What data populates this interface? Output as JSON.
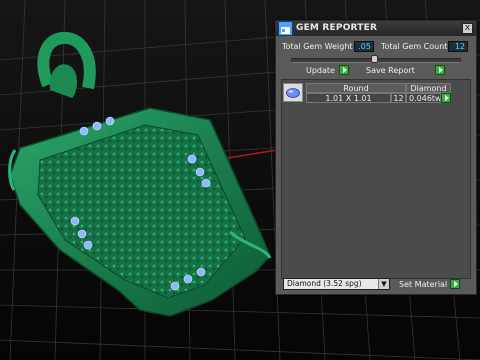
{
  "window": {
    "title": "GEM REPORTER",
    "close_glyph": "x"
  },
  "stats": {
    "total_gem_weight_label": "Total Gem Weight",
    "total_gem_weight_value": ".05",
    "total_gem_count_label": "Total Gem Count",
    "total_gem_count_value": "12"
  },
  "actions": {
    "update_label": "Update",
    "save_report_label": "Save Report"
  },
  "table": {
    "shape_header": "Round",
    "material_header": "Diamond",
    "rows": [
      {
        "size": "1.01 X 1.01",
        "count": "12",
        "weight": "0.046tw"
      }
    ]
  },
  "footer": {
    "material_selected": "Diamond    (3.52 spg)",
    "set_material_label": "Set Material"
  },
  "colors": {
    "model_green": "#1f8f5a",
    "gem_marker": "#8fb8ff",
    "value_text": "#4fd1ff",
    "go_button": "#34b23a"
  },
  "icons": {
    "app": "app-icon",
    "close": "close-icon",
    "gem": "round-gem-icon",
    "go": "play-arrow-icon",
    "dropdown": "chevron-down-icon"
  }
}
